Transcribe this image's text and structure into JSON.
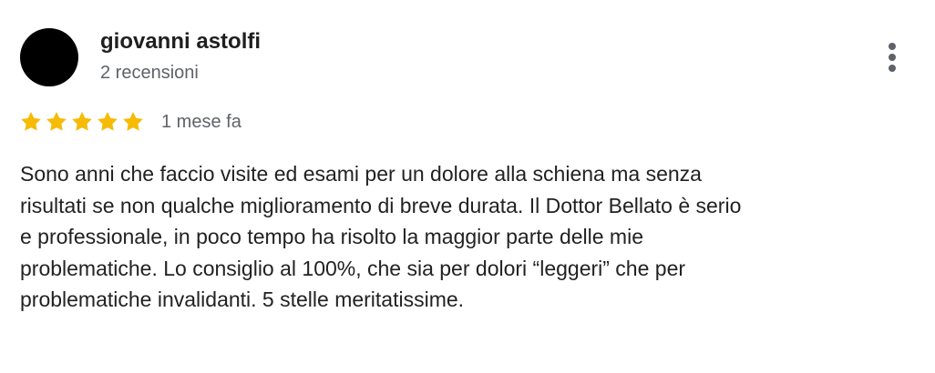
{
  "review": {
    "author_name": "giovanni astolfi",
    "author_meta": "2 recensioni",
    "rating": 5,
    "rating_max": 5,
    "date": "1 mese fa",
    "star_color": "#F6BB06",
    "more_icon": "more-vert-icon",
    "text_lines": [
      "Sono anni che faccio visite ed esami per un dolore alla schiena ma senza",
      "risultati se non qualche miglioramento di breve durata. Il Dottor Bellato è serio",
      "e professionale, in poco tempo ha risolto la maggior parte delle mie",
      "problematiche. Lo consiglio al 100%, che sia per dolori “leggeri” che per",
      "problematiche invalidanti. 5 stelle meritatissime."
    ]
  }
}
